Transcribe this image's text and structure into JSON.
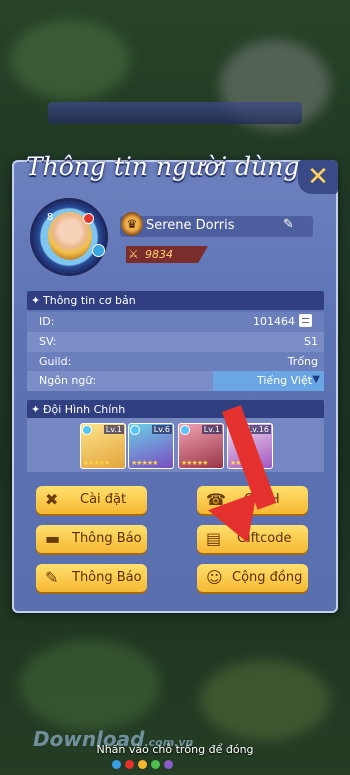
{
  "panel": {
    "title": "Thông tin người dùng"
  },
  "profile": {
    "level": "8",
    "name": "Serene Dorris",
    "power": "9834"
  },
  "basic": {
    "header": "Thông tin cơ bản",
    "rows": [
      {
        "label": "ID:",
        "value": "101464"
      },
      {
        "label": "SV:",
        "value": "S1"
      },
      {
        "label": "Guild:",
        "value": "Trống"
      },
      {
        "label": "Ngôn ngữ:",
        "value": "Tiếng Việt"
      }
    ]
  },
  "team": {
    "header": "Đội Hình Chính",
    "heroes": [
      {
        "level": "Lv.1",
        "color": "#f6c94d"
      },
      {
        "level": "Lv.6",
        "color": "#8d5cc8"
      },
      {
        "level": "Lv.1",
        "color": "#b84a5a"
      },
      {
        "level": "Lv.16",
        "color": "#c36ec9"
      }
    ]
  },
  "buttons": {
    "settings": "Cài đặt",
    "cskh": "CSKH",
    "notice1": "Thông Báo",
    "giftcode": "Giftcode",
    "notice2": "Thông Báo",
    "community": "Cộng đồng"
  },
  "footer": {
    "hint": "Nhấn vào chỗ trống để đóng",
    "watermark": "Download",
    "watermark_suffix": ".com.vn"
  },
  "colors": {
    "accent": "#e5312d",
    "button": "#f6b832",
    "panel": "#5c72b3"
  }
}
